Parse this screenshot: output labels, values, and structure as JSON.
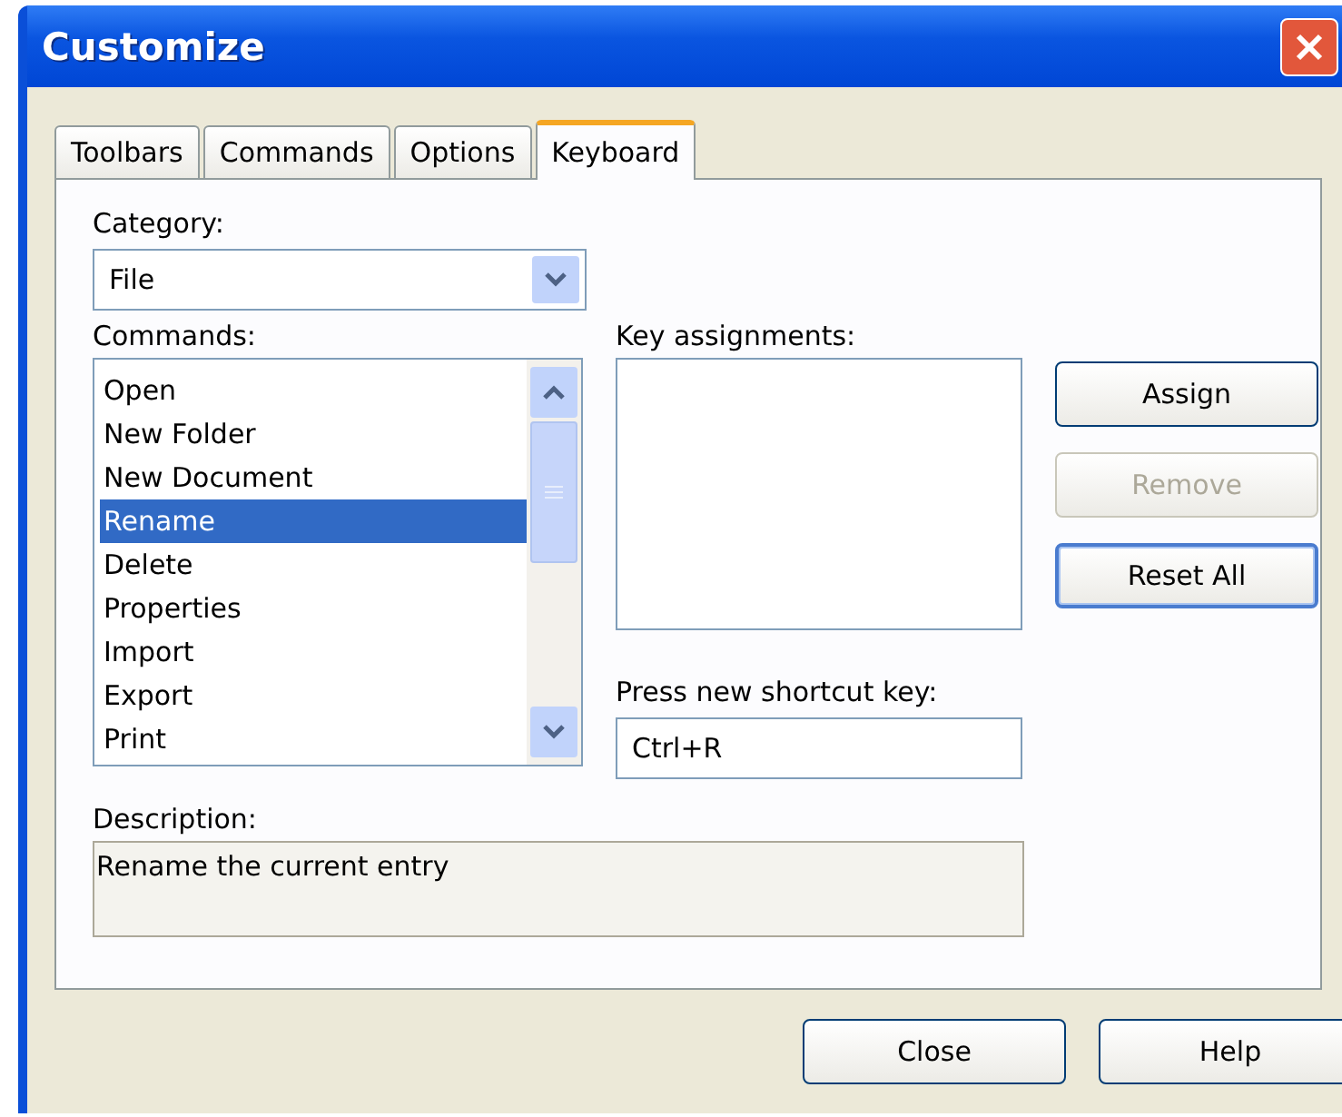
{
  "window": {
    "title": "Customize"
  },
  "tabs": [
    {
      "label": "Toolbars",
      "selected": false
    },
    {
      "label": "Commands",
      "selected": false
    },
    {
      "label": "Options",
      "selected": false
    },
    {
      "label": "Keyboard",
      "selected": true
    }
  ],
  "category": {
    "label": "Category:",
    "value": "File"
  },
  "commands": {
    "label": "Commands:",
    "items": [
      {
        "label": "Open",
        "selected": false
      },
      {
        "label": "New Folder",
        "selected": false
      },
      {
        "label": "New Document",
        "selected": false
      },
      {
        "label": "Rename",
        "selected": true
      },
      {
        "label": "Delete",
        "selected": false
      },
      {
        "label": "Properties",
        "selected": false
      },
      {
        "label": "Import",
        "selected": false
      },
      {
        "label": "Export",
        "selected": false
      },
      {
        "label": "Print",
        "selected": false
      }
    ]
  },
  "key_assignments": {
    "label": "Key assignments:"
  },
  "side_buttons": [
    {
      "label": "Assign",
      "disabled": false,
      "focused": false
    },
    {
      "label": "Remove",
      "disabled": true,
      "focused": false
    },
    {
      "label": "Reset All",
      "disabled": false,
      "focused": true
    }
  ],
  "shortcut": {
    "label": "Press new shortcut key:",
    "value": "Ctrl+R"
  },
  "description": {
    "label": "Description:",
    "text": "Rename the current entry"
  },
  "footer_buttons": [
    {
      "label": "Close"
    },
    {
      "label": "Help"
    }
  ]
}
